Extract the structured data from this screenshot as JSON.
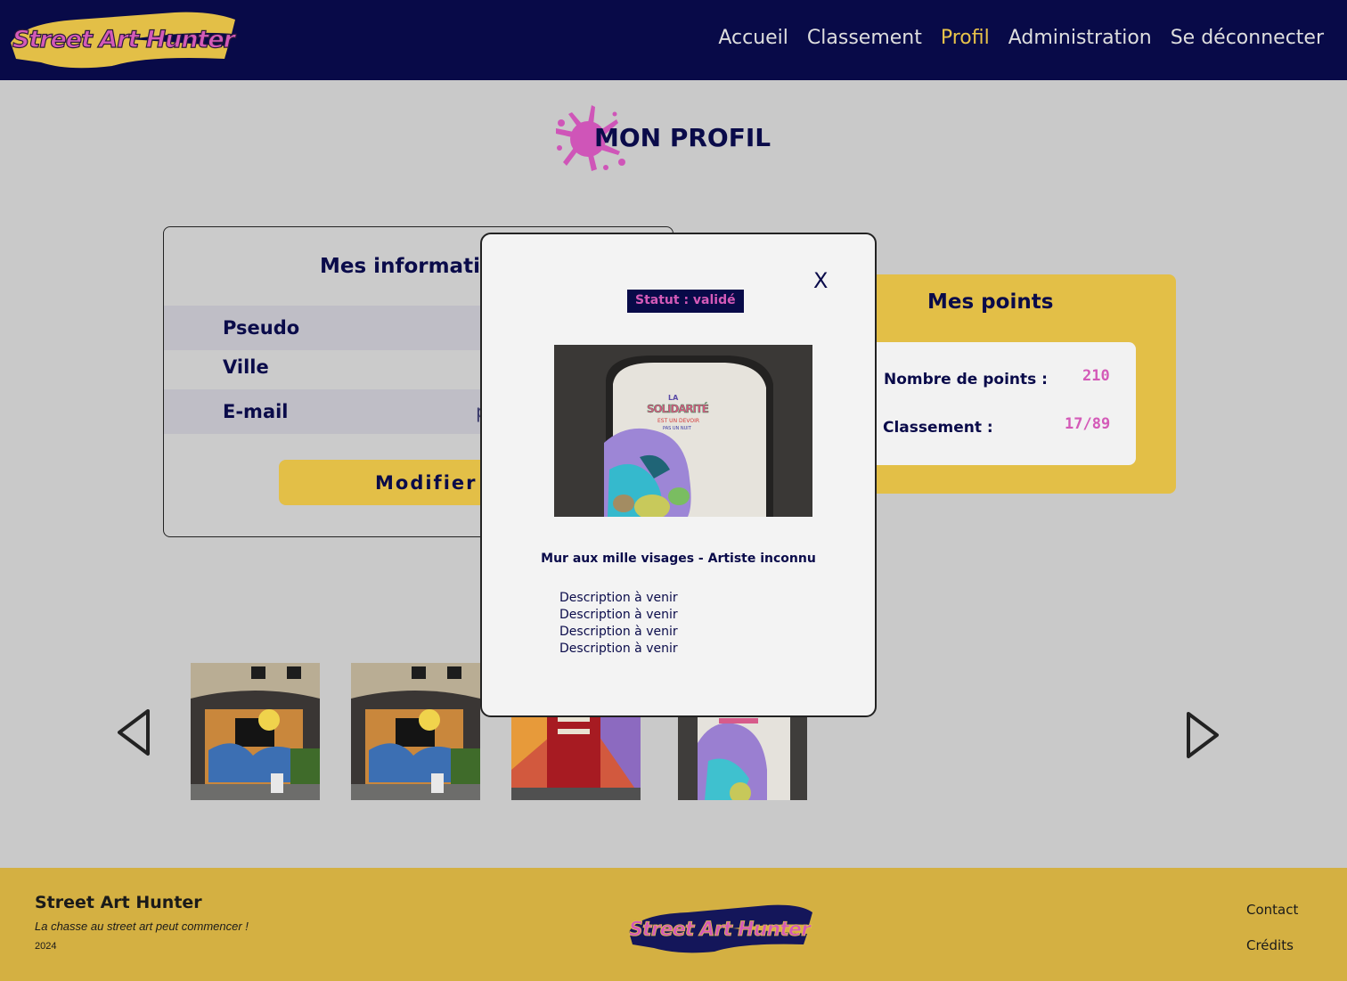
{
  "brand": {
    "logo_text": "Street Art Hunter"
  },
  "nav": {
    "items": [
      {
        "label": "Accueil",
        "active": false
      },
      {
        "label": "Classement",
        "active": false
      },
      {
        "label": "Profil",
        "active": true
      },
      {
        "label": "Administration",
        "active": false
      },
      {
        "label": "Se déconnecter",
        "active": false
      }
    ]
  },
  "page": {
    "title": "MON PROFIL"
  },
  "info": {
    "title": "Mes informations",
    "rows": [
      {
        "label": "Pseudo",
        "value": ""
      },
      {
        "label": "Ville",
        "value": ""
      },
      {
        "label": "E-mail",
        "value": "p"
      }
    ],
    "modify_label": "Modifier"
  },
  "points": {
    "title": "Mes points",
    "points_label": "Nombre de points :",
    "points_value": "210",
    "rank_label": "Classement :",
    "rank_value": "17/89"
  },
  "gallery": {
    "thumbnails": [
      "artwork-1",
      "artwork-2",
      "artwork-3",
      "artwork-4"
    ]
  },
  "modal": {
    "close_label": "X",
    "status": "Statut : validé",
    "heading": "Mur aux mille visages - Artiste inconnu",
    "description": [
      "Description à venir",
      "Description à venir",
      "Description à venir",
      "Description à venir"
    ],
    "photo_text": [
      "LA",
      "SOLIDARITÉ",
      "EST UN DEVOIR",
      "PAS UN NUIT"
    ]
  },
  "footer": {
    "name": "Street Art Hunter",
    "tagline": "La chasse au street art peut commencer !",
    "year": "2024",
    "logo_text": "Street Art Hunter",
    "links": [
      "Contact",
      "Crédits"
    ]
  },
  "colors": {
    "navy": "#080a48",
    "gold": "#e3bf47",
    "pink": "#d45ab8",
    "background": "#c9c9c9"
  }
}
